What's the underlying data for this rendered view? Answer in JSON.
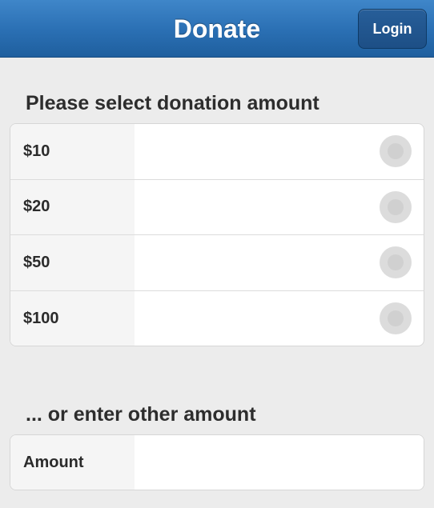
{
  "header": {
    "title": "Donate",
    "login_label": "Login"
  },
  "options_section": {
    "heading": "Please select donation amount",
    "options": [
      {
        "label": "$10",
        "selected": false
      },
      {
        "label": "$20",
        "selected": false
      },
      {
        "label": "$50",
        "selected": false
      },
      {
        "label": "$100",
        "selected": false
      }
    ]
  },
  "other_section": {
    "heading": "... or enter other amount",
    "field_label": "Amount",
    "field_value": "",
    "field_placeholder": ""
  },
  "colors": {
    "header_blue": "#2a6fb3",
    "page_background": "#ececec",
    "radio_gray": "#dcdcdc"
  }
}
